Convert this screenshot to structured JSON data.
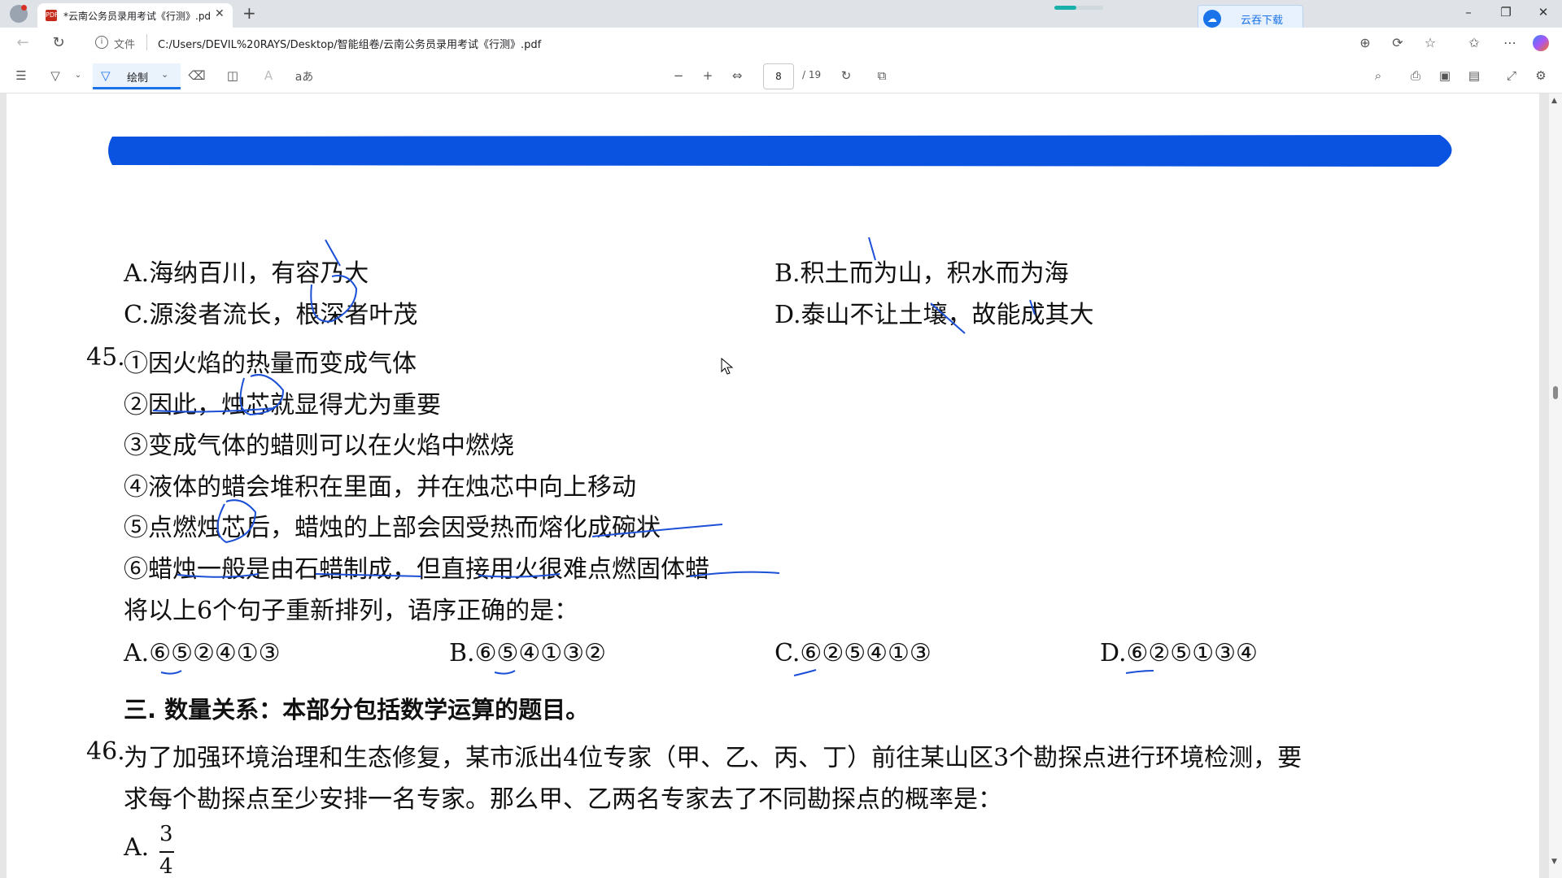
{
  "browser": {
    "tab_title": "*云南公务员录用考试《行测》.pdf",
    "tab_pdf_icon": "PDF",
    "new_tab_glyph": "+",
    "close_glyph": "✕",
    "cloud_download_label": "云吞下载",
    "address_file_label": "文件",
    "url": "C:/Users/DEVIL%20RAYS/Desktop/智能组卷/云南公务员录用考试《行测》.pdf",
    "download_progress": 0.45,
    "icons": [
      "profile-icon",
      "back-icon",
      "refresh-icon",
      "info-icon",
      "zoom-icon",
      "read-aloud-icon",
      "favorite-icon",
      "favorites-icon",
      "more-icon",
      "copilot-icon"
    ]
  },
  "pdf_toolbar": {
    "draw_label": "绘制",
    "current_page": "8",
    "total_pages": "/ 19",
    "zoom_out": "−",
    "zoom_in": "+",
    "read_aloud": "aあ",
    "icons": [
      "contents-icon",
      "highlight-icon",
      "draw-icon",
      "eraser-icon",
      "page-view-icon",
      "text-icon",
      "fit-width-icon",
      "rotate-icon",
      "two-page-icon",
      "search-icon",
      "print-icon",
      "save-icon",
      "save-as-icon",
      "fullscreen-icon",
      "settings-icon"
    ]
  },
  "document": {
    "q44_options": {
      "a": "A.海纳百川，有容乃大",
      "b": "B.积土而为山，积水而为海",
      "c": "C.源浚者流长，根深者叶茂",
      "d": "D.泰山不让土壤，故能成其大"
    },
    "q45": {
      "number": "45.",
      "sentences": [
        "①因火焰的热量而变成气体",
        "②因此，烛芯就显得尤为重要",
        "③变成气体的蜡则可以在火焰中燃烧",
        "④液体的蜡会堆积在里面，并在烛芯中向上移动",
        "⑤点燃烛芯后，蜡烛的上部会因受热而熔化成碗状",
        "⑥蜡烛一般是由石蜡制成，但直接用火很难点燃固体蜡"
      ],
      "prompt": "将以上6个句子重新排列，语序正确的是：",
      "options": {
        "a": "A.⑥⑤②④①③",
        "b": "B.⑥⑤④①③②",
        "c": "C.⑥②⑤④①③",
        "d": "D.⑥②⑤①③④"
      }
    },
    "section3_heading": "三. 数量关系：本部分包括数学运算的题目。",
    "q46": {
      "number": "46.",
      "line1": "为了加强环境治理和生态修复，某市派出4位专家（甲、乙、丙、丁）前往某山区3个勘探点进行环境检测，要",
      "line2": "求每个勘探点至少安排一名专家。那么甲、乙两名专家去了不同勘探点的概率是：",
      "option_a_label": "A.",
      "option_a_num": "3",
      "option_a_den": "4"
    },
    "colors": {
      "ink": "#1b4fd6",
      "redaction_bar": "#0a52e0",
      "accent": "#1a73e8"
    }
  }
}
